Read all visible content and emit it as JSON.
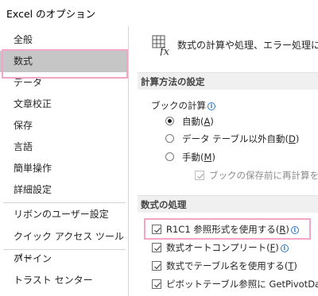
{
  "window": {
    "title": "Excel のオプション"
  },
  "nav": {
    "items": [
      {
        "label": "全般",
        "selected": false
      },
      {
        "label": "数式",
        "selected": true
      },
      {
        "label": "データ",
        "selected": false
      },
      {
        "label": "文章校正",
        "selected": false
      },
      {
        "label": "保存",
        "selected": false
      },
      {
        "label": "言語",
        "selected": false
      },
      {
        "label": "簡単操作",
        "selected": false
      },
      {
        "label": "詳細設定",
        "selected": false
      },
      {
        "label": "リボンのユーザー設定",
        "selected": false
      },
      {
        "label": "クイック アクセス ツール バー",
        "selected": false
      },
      {
        "label": "アドイン",
        "selected": false
      },
      {
        "label": "トラスト センター",
        "selected": false
      }
    ]
  },
  "header": {
    "icon": "fx-grid-icon",
    "text": "数式の計算や処理、エラー処理に"
  },
  "calc": {
    "section_title": "計算方法の設定",
    "workbook_calc_label": "ブックの計算",
    "options": [
      {
        "label": "自動",
        "key": "A",
        "checked": true
      },
      {
        "label": "データ テーブル以外自動",
        "key": "D",
        "checked": false
      },
      {
        "label": "手動",
        "key": "M",
        "checked": false
      }
    ],
    "recalc_before_save": {
      "label": "ブックの保存前に再計算を行",
      "checked": true,
      "disabled": true
    }
  },
  "formulas": {
    "section_title": "数式の処理",
    "options": [
      {
        "label": "R1C1 参照形式を使用する",
        "key": "R",
        "checked": true,
        "info": true
      },
      {
        "label": "数式オートコンプリート",
        "key": "F",
        "checked": true,
        "info": true
      },
      {
        "label": "数式でテーブル名を使用する",
        "key": "T",
        "checked": true,
        "info": false
      },
      {
        "label": "ピボットテーブル参照に GetPivotData",
        "key": "",
        "checked": true,
        "info": false
      }
    ]
  },
  "colors": {
    "highlight": "#f3a5c5",
    "selected_bg": "#c6c6c6",
    "info": "#2b78c5",
    "check_gray": "#6b6b6b"
  }
}
